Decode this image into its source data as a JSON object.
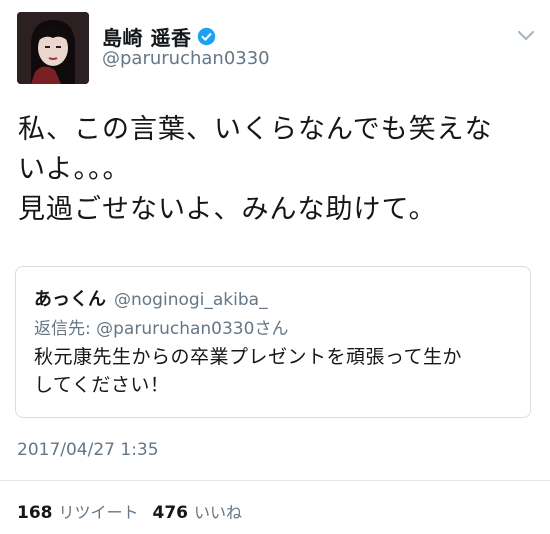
{
  "author": {
    "display_name": "島崎 遥香",
    "handle": "@paruruchan0330"
  },
  "tweet": {
    "text": "私、この言葉、いくらなんでも笑えな\nいよ。。。\n見過ごせないよ、みんな助けて。"
  },
  "quoted": {
    "name": "あっくん",
    "handle": "@noginogi_akiba_",
    "reply_to": "返信先: @paruruchan0330さん",
    "text": "秋元康先生からの卒業プレゼントを頑張って生か\nしてください！"
  },
  "timestamp": "2017/04/27 1:35",
  "stats": {
    "retweets": "168",
    "retweets_label": "リツイート",
    "likes": "476",
    "likes_label": "いいね"
  },
  "colors": {
    "verified_blue": "#1da1f2",
    "secondary_text": "#657786"
  },
  "icons": {
    "verified": "verified-badge-icon",
    "menu": "chevron-down-icon"
  }
}
